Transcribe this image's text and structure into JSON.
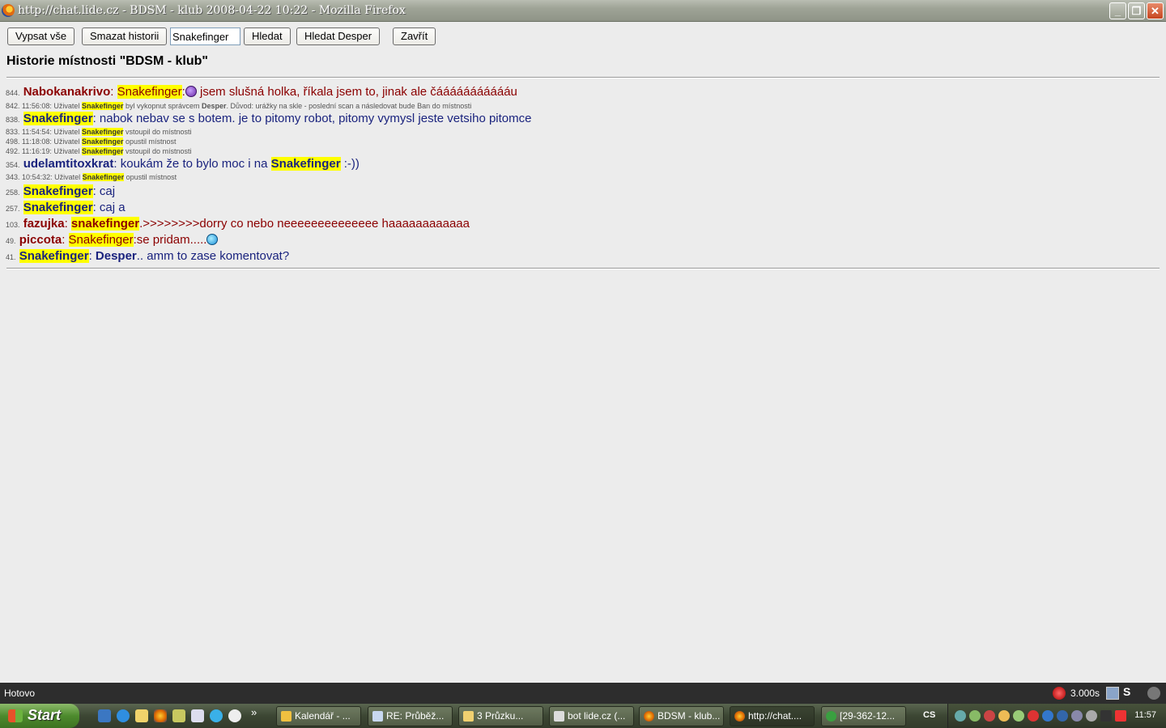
{
  "window": {
    "title": "http://chat.lide.cz - BDSM - klub 2008-04-22 10:22 - Mozilla Firefox"
  },
  "toolbar": {
    "list_all": "Vypsat vše",
    "clear_history": "Smazat historii",
    "search_value": "Snakefinger",
    "search": "Hledat",
    "search_desper": "Hledat Desper",
    "close": "Zavřít"
  },
  "heading": "Historie místnosti \"BDSM - klub\"",
  "messages": [
    {
      "num": "844.",
      "nick": "Nabokanakrivo",
      "sep": ": ",
      "mention": "Snakefinger",
      "after": ":",
      "emoticon": "purple",
      "text": " jsem slušná holka, říkala jsem to, jinak ale čáááááááááááu",
      "color": "red"
    },
    {
      "num": "842.",
      "time": "11:56:08:",
      "pre": " Uživatel ",
      "user": "Snakefinger",
      "text": " byl vykopnut správcem ",
      "admin": "Desper",
      "reason": ". Důvod: urážky na skle - poslední scan a následovat bude Ban do místnosti"
    },
    {
      "num": "838.",
      "nick": "Snakefinger",
      "text": ": nabok nebav se s botem. je to pitomy robot, pitomy vymysl jeste vetsiho pitomce"
    },
    {
      "num": "833.",
      "time": "11:54:54:",
      "pre": " Uživatel ",
      "user": "Snakefinger",
      "text": " vstoupil do místnosti"
    },
    {
      "num": "498.",
      "time": "11:18:08:",
      "pre": " Uživatel ",
      "user": "Snakefinger",
      "text": " opustil místnost"
    },
    {
      "num": "492.",
      "time": "11:16:19:",
      "pre": " Uživatel ",
      "user": "Snakefinger",
      "text": " vstoupil do místnosti"
    },
    {
      "num": "354.",
      "nick": "udelamtitoxkrat",
      "text": ": koukám že to bylo moc i na ",
      "mention": "Snakefinger",
      "after": " :-))"
    },
    {
      "num": "343.",
      "time": "10:54:32:",
      "pre": " Uživatel ",
      "user": "Snakefinger",
      "text": " opustil místnost"
    },
    {
      "num": "258.",
      "nick": "Snakefinger",
      "text": ": caj"
    },
    {
      "num": "257.",
      "nick": "Snakefinger",
      "text": ": caj a"
    },
    {
      "num": "103.",
      "nick": "fazujka",
      "sep": ": ",
      "mention": "snakefinger",
      "after": ".>>>>>>>>dorry co nebo neeeeeeeeeeeeee haaaaaaaaaaaa",
      "color": "red"
    },
    {
      "num": "49.",
      "nick": "piccota",
      "sep": ": ",
      "mention": "Snakefinger",
      "after": ":se pridam.....",
      "emoticon": "cyan",
      "color": "red"
    },
    {
      "num": "41.",
      "nick": "Snakefinger",
      "text": ": ",
      "mention2": "Desper",
      "after": ".. amm to zase komentovat?"
    }
  ],
  "statusbar": {
    "status": "Hotovo",
    "ping": "3.000s",
    "s_label": "S"
  },
  "taskbar": {
    "start": "Start",
    "more": "»",
    "tasks": [
      {
        "label": "Kalendář - ...",
        "active": false
      },
      {
        "label": "RE: Průběž...",
        "active": false
      },
      {
        "label": "3 Průzku...",
        "active": false
      },
      {
        "label": "bot lide.cz (...",
        "active": false
      },
      {
        "label": "BDSM - klub...",
        "active": false
      },
      {
        "label": "http://chat....",
        "active": true
      },
      {
        "label": "[29-362-12...",
        "active": false
      }
    ],
    "lang": "CS",
    "clock": "11:57"
  },
  "colors": {
    "highlight": "#ffff00",
    "nick_red": "#8b0000",
    "nick_blue": "#1a237e"
  }
}
